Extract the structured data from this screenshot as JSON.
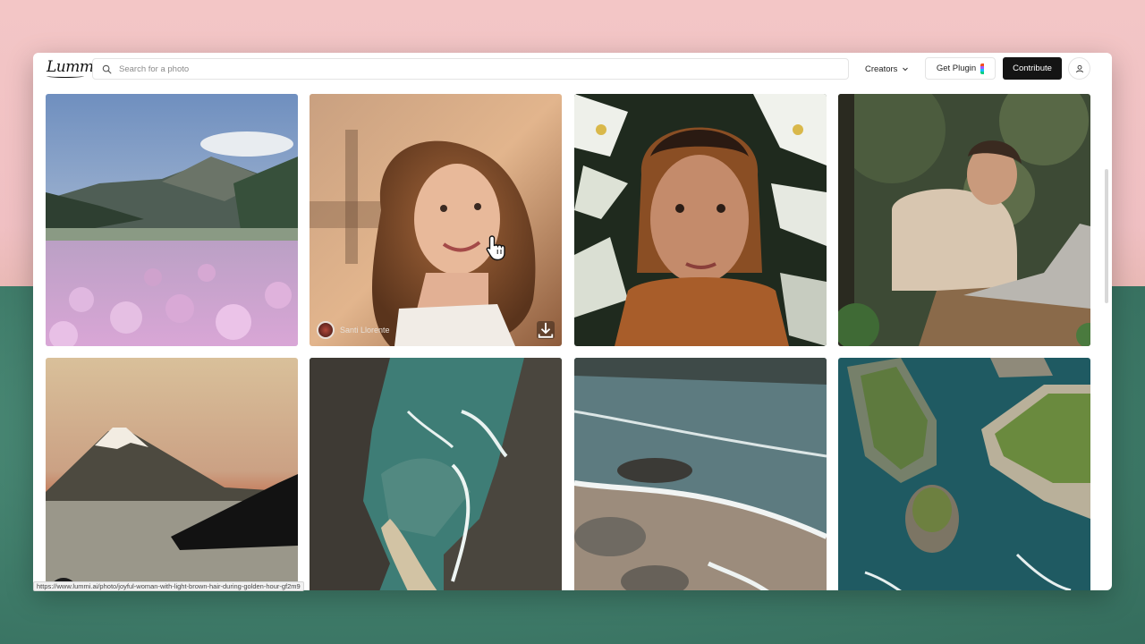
{
  "app": {
    "logo": "Lummi"
  },
  "search": {
    "placeholder": "Search for a photo",
    "value": ""
  },
  "nav": {
    "creators_label": "Creators",
    "plugin_label": "Get Plugin",
    "contribute_label": "Contribute"
  },
  "photos": [
    {
      "subject": "mountain-flower-field"
    },
    {
      "subject": "woman-light-brown-hair",
      "credit": "Santi Llorente"
    },
    {
      "subject": "woman-with-lilies"
    },
    {
      "subject": "man-with-laptop"
    },
    {
      "subject": "mountain-painting"
    },
    {
      "subject": "coastal-cliffs"
    },
    {
      "subject": "beach-rocks"
    },
    {
      "subject": "islands-aerial"
    }
  ],
  "status_bar": {
    "url": "https://www.lummi.ai/photo/joyful-woman-with-light-brown-hair-during-golden-hour-gf2m9"
  },
  "colors": {
    "contribute_bg": "#141414",
    "window_bg": "#ffffff",
    "desktop_top": "#f3c6c6",
    "desktop_bottom": "#3f7f6f"
  },
  "icons": [
    "search-icon",
    "chevron-down-icon",
    "figma-icon",
    "user-icon",
    "download-icon",
    "hand-cursor-icon"
  ]
}
